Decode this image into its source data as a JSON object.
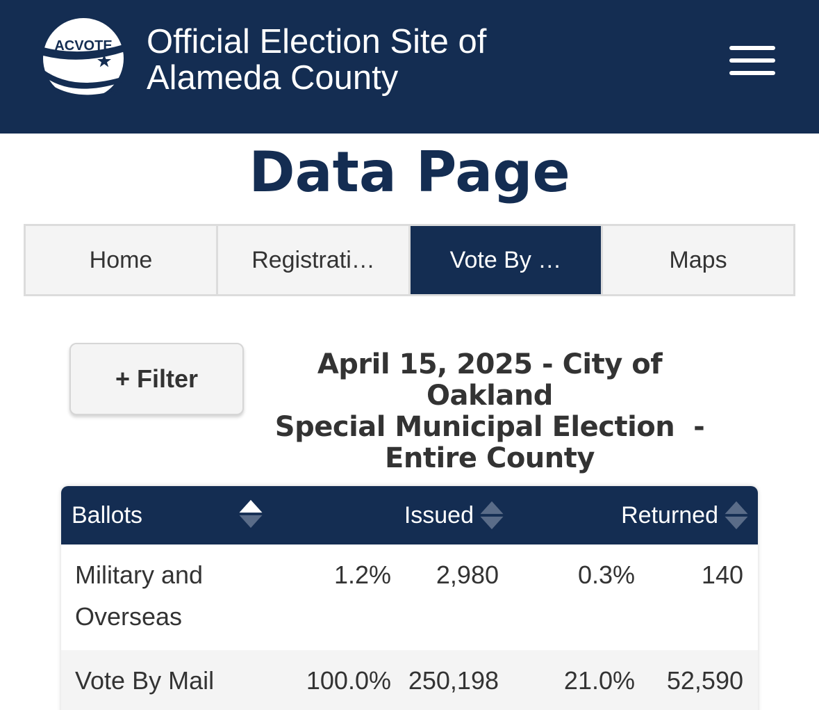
{
  "header": {
    "logo_text": "ACVOTE",
    "title_line1": "Official Election Site of",
    "title_line2": "Alameda County"
  },
  "page_title": "Data Page",
  "tabs": [
    {
      "label": "Home",
      "active": false
    },
    {
      "label": "Registrati…",
      "active": false
    },
    {
      "label": "Vote By …",
      "active": true
    },
    {
      "label": "Maps",
      "active": false
    }
  ],
  "filter": {
    "label": "+ Filter"
  },
  "election": {
    "line1": "April 15, 2025 - City of Oakland",
    "line2": "Special Municipal Election  -",
    "line3": "Entire County"
  },
  "table": {
    "headers": {
      "ballots": "Ballots",
      "issued": "Issued",
      "returned": "Returned"
    },
    "rows": [
      {
        "label_line1": "Military and",
        "label_line2": "Overseas",
        "issued_pct": "1.2%",
        "issued": "2,980",
        "returned_pct": "0.3%",
        "returned": "140"
      },
      {
        "label_line1": "Vote By Mail",
        "label_line2": "",
        "issued_pct": "100.0%",
        "issued": "250,198",
        "returned_pct": "21.0%",
        "returned": "52,590"
      }
    ]
  },
  "colors": {
    "brand_navy": "#142d52",
    "tab_bg": "#f4f4f4"
  }
}
